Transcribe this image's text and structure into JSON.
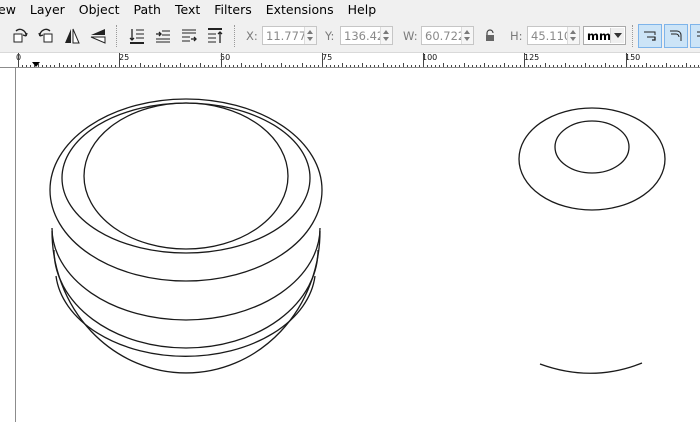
{
  "menu": {
    "items": [
      {
        "name": "menu-view",
        "label": "ew"
      },
      {
        "name": "menu-layer",
        "label": "Layer"
      },
      {
        "name": "menu-object",
        "label": "Object"
      },
      {
        "name": "menu-path",
        "label": "Path"
      },
      {
        "name": "menu-text",
        "label": "Text"
      },
      {
        "name": "menu-filters",
        "label": "Filters"
      },
      {
        "name": "menu-extensions",
        "label": "Extensions"
      },
      {
        "name": "menu-help",
        "label": "Help"
      }
    ]
  },
  "toolbar": {
    "icons": [
      "rotate-ccw-icon",
      "rotate-cw-icon",
      "flip-horizontal-icon",
      "flip-vertical-icon",
      "lower-to-bottom-icon",
      "lower-icon",
      "raise-icon",
      "raise-to-top-icon"
    ],
    "x_label": "X:",
    "x_value": "11.777",
    "y_label": "Y:",
    "y_value": "136.420",
    "w_label": "W:",
    "w_value": "60.722",
    "lock_icon": "lock-icon",
    "h_label": "H:",
    "h_value": "45.110",
    "unit": "mm",
    "toggle_icons": [
      "scale-stroke-icon",
      "scale-corners-icon",
      "move-gradients-icon"
    ]
  },
  "ruler": {
    "labels": [
      "0",
      "25",
      "50",
      "75",
      "100",
      "125",
      "150"
    ]
  },
  "colors": {
    "chrome": "#f0f0f0",
    "active_toggle": "#cce4f7",
    "stroke": "#1a1a1a"
  }
}
